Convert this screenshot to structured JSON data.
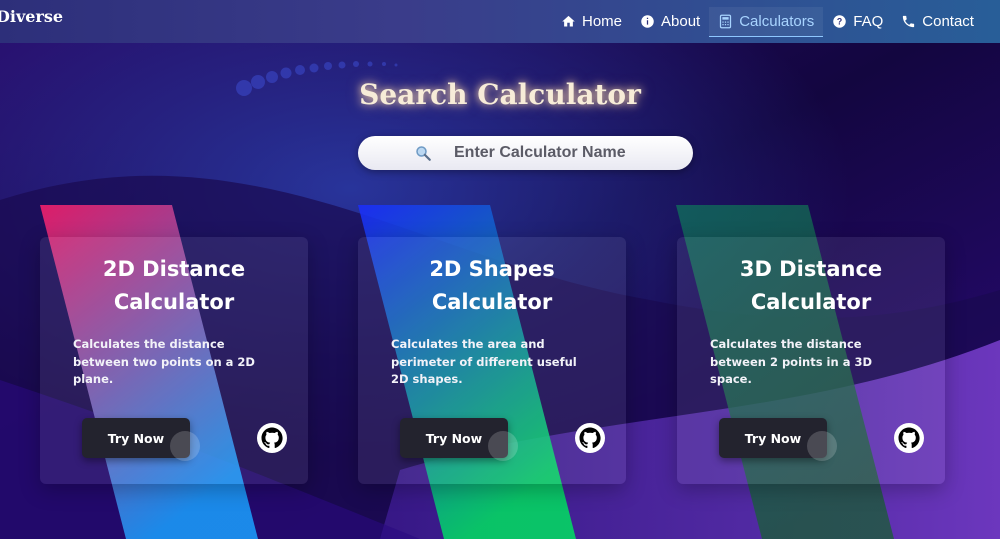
{
  "brand": "Diverse",
  "nav": [
    {
      "label": "Home",
      "icon": "home-icon"
    },
    {
      "label": "About",
      "icon": "info-icon"
    },
    {
      "label": "Calculators",
      "icon": "calculator-icon",
      "active": true
    },
    {
      "label": "FAQ",
      "icon": "question-icon"
    },
    {
      "label": "Contact",
      "icon": "phone-icon"
    }
  ],
  "search": {
    "title": "Search Calculator",
    "placeholder": "Enter Calculator Name"
  },
  "cards": [
    {
      "title": "2D Distance Calculator",
      "description": "Calculates the distance between two points on a 2D plane.",
      "button": "Try Now",
      "accent_from": "#ff1f6b",
      "accent_to": "#1aa0ff"
    },
    {
      "title": "2D Shapes Calculator",
      "description": "Calculates the area and perimeter of different useful 2D shapes.",
      "button": "Try Now",
      "accent_from": "#1a2cff",
      "accent_to": "#00e060"
    },
    {
      "title": "3D Distance Calculator",
      "description": "Calculates the distance between 2 points in a 3D space.",
      "button": "Try Now",
      "accent_from": "#0f6b5c",
      "accent_to": "#1c5a3a"
    }
  ],
  "colors": {
    "background": "#1a0a4a",
    "navbar": "#2d2f7a",
    "active_nav": "#a8d4ff"
  }
}
